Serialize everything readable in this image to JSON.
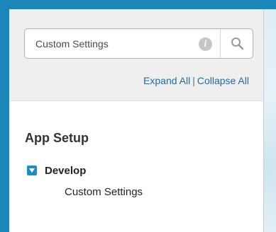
{
  "search": {
    "value": "Custom Settings",
    "info_icon": "info-icon",
    "search_icon": "search-icon"
  },
  "tree_controls": {
    "expand_all": "Expand All",
    "separator": "|",
    "collapse_all": "Collapse All"
  },
  "section": {
    "title": "App Setup",
    "node": {
      "label": "Develop",
      "icon": "collapse-toggle-icon",
      "expanded": true,
      "children": [
        "Custom Settings"
      ]
    }
  },
  "colors": {
    "frame": "#1b86ba",
    "toggle": "#1e8cc7",
    "link": "#1e6da3",
    "panel": "#efefef"
  }
}
